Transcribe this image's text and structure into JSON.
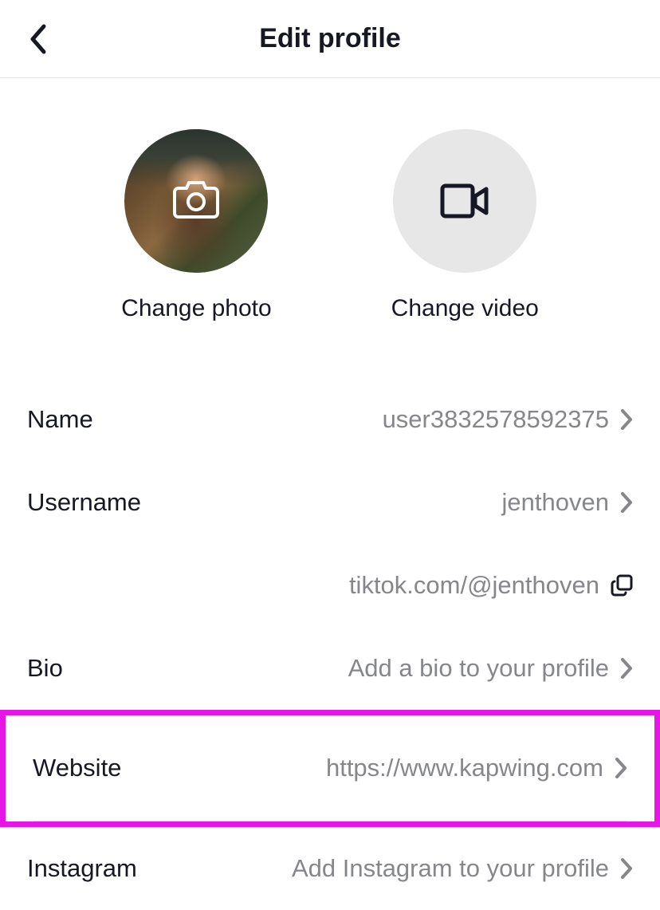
{
  "header": {
    "title": "Edit profile"
  },
  "media": {
    "photo_label": "Change photo",
    "video_label": "Change video"
  },
  "fields": {
    "name": {
      "label": "Name",
      "value": "user3832578592375"
    },
    "username": {
      "label": "Username",
      "value": "jenthoven"
    },
    "profile_url": "tiktok.com/@jenthoven",
    "bio": {
      "label": "Bio",
      "value": "Add a bio to your profile"
    },
    "website": {
      "label": "Website",
      "value": "https://www.kapwing.com"
    },
    "instagram": {
      "label": "Instagram",
      "value": "Add Instagram to your profile"
    }
  }
}
